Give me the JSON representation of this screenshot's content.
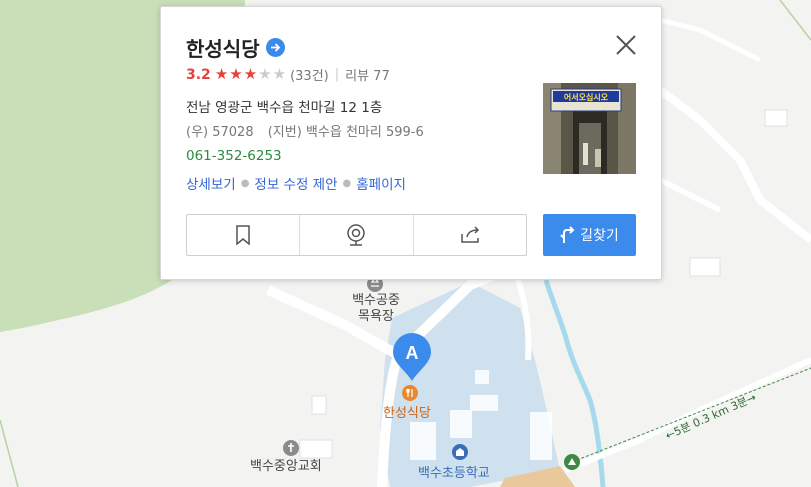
{
  "place": {
    "name": "한성식당",
    "rating": "3.2",
    "stars_filled": 3,
    "stars_total": 5,
    "rating_count": "(33건)",
    "review_label": "리뷰 77",
    "address": "전남 영광군 백수읍 천마길 12 1층",
    "postal_code": "(우) 57028",
    "jibun_address": "(지번) 백수읍 천마리 599-6",
    "phone": "061-352-6253",
    "links": [
      "상세보기",
      "정보 수정 제안",
      "홈페이지"
    ],
    "photo_sign_text": "어서오십시오",
    "route_label": "길찾기",
    "action_icons": [
      "bookmark-icon",
      "street-view-icon",
      "share-icon"
    ]
  },
  "map": {
    "bath_label": "백수공중\n목욕장",
    "marker_letter": "A",
    "restaurant_label": "한성식당",
    "church_label": "백수중앙교회",
    "school_label": "백수초등학교",
    "walk_route": "←5분 0.3 km 3분→"
  },
  "colors": {
    "accent_blue": "#3b8bec",
    "rating_red": "#e8413c",
    "phone_green": "#2d8a3e",
    "link_blue": "#3367d6",
    "forest_green": "#c9dfb8",
    "school_blue": "#cfe1ee",
    "river_blue": "#a6d9ec"
  }
}
